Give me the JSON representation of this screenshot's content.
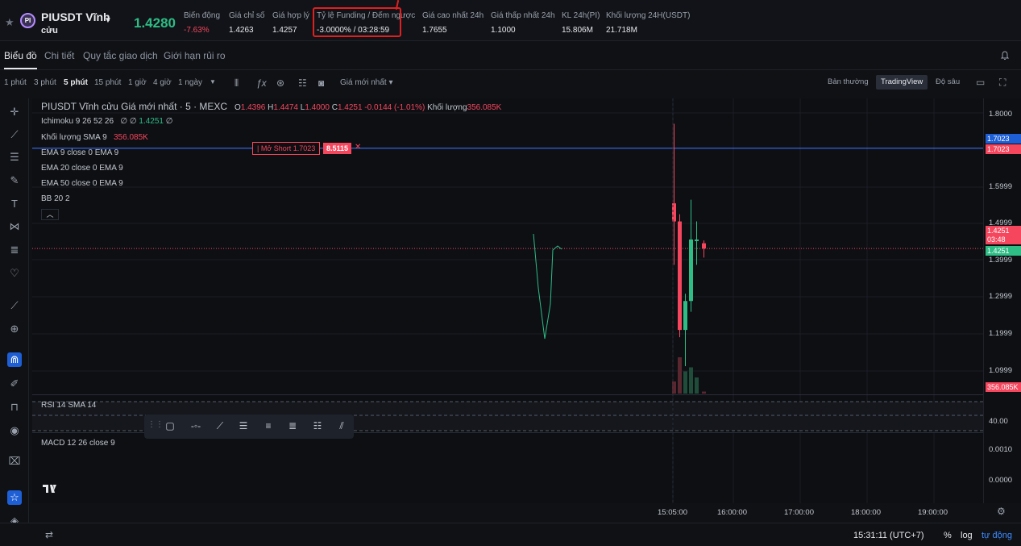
{
  "ticker": {
    "symbol": "PIUSDT Vĩnh",
    "symbol_line2": "cửu",
    "coin_icon": "PI",
    "last_price": "1.4280",
    "stats": [
      {
        "label": "Biến động",
        "value": "-7.63%",
        "tone": "red"
      },
      {
        "label": "Giá chỉ số",
        "value": "1.4263",
        "tone": "normal"
      },
      {
        "label": "Giá hợp lý",
        "value": "1.4257",
        "tone": "normal"
      },
      {
        "label": "Tỷ lệ Funding / Đếm ngược",
        "value": "-3.0000% / 03:28:59",
        "tone": "normal"
      },
      {
        "label": "Giá cao nhất 24h",
        "value": "1.7655",
        "tone": "normal"
      },
      {
        "label": "Giá thấp nhất 24h",
        "value": "1.1000",
        "tone": "normal"
      },
      {
        "label": "KL 24h(PI)",
        "value": "15.806M",
        "tone": "normal"
      },
      {
        "label": "Khối lượng 24H(USDT)",
        "value": "21.718M",
        "tone": "normal"
      }
    ]
  },
  "tabs": [
    "Biểu đồ",
    "Chi tiết",
    "Quy tắc giao dịch",
    "Giới hạn rủi ro"
  ],
  "toolbar": {
    "timeframes": [
      "1 phút",
      "3 phút",
      "5 phút",
      "15 phút",
      "1 giờ",
      "4 giờ",
      "1 ngày"
    ],
    "active_timeframe": "5 phút",
    "price_type": "Giá mới nhất",
    "views": [
      "Bản thường",
      "TradingView",
      "Độ sâu"
    ],
    "active_view": "TradingView"
  },
  "chart_header": {
    "title": "PIUSDT Vĩnh cửu Giá mới nhất · 5 · MEXC",
    "o_label": "O",
    "o": "1.4396",
    "h_label": "H",
    "h": "1.4474",
    "l_label": "L",
    "l": "1.4000",
    "c_label": "C",
    "c": "1.4251",
    "change": "-0.0144 (-1.01%)",
    "vol_label": "Khối lượng",
    "vol": "356.085K"
  },
  "indicators": {
    "ichimoku": "Ichimoku 9 26 52 26",
    "ichimoku_vals": "∅  ∅",
    "ichimoku_price": "1.4251",
    "ichimoku_end": "∅",
    "volume_sma": "Khối lượng SMA 9",
    "volume_sma_val": "356.085K",
    "ema9": "EMA 9 close 0 EMA 9",
    "ema20": "EMA 20 close 0 EMA 9",
    "ema50": "EMA 50 close 0 EMA 9",
    "bb": "BB 20 2",
    "rsi": "RSI 14 SMA 14",
    "macd": "MACD 12 26 close 9"
  },
  "short_order": {
    "label": "Mở Short 1.7023",
    "qty": "8.5115"
  },
  "price_axis": {
    "labels": [
      "1.8000",
      "1.5999",
      "1.4999",
      "1.3999",
      "1.2999",
      "1.1999",
      "1.0999"
    ],
    "short_line": "1.7023",
    "current": "1.4251",
    "countdown": "03:48",
    "volume_tag": "356.085K",
    "rsi_level": "40.00",
    "macd_levels": [
      "0.0010",
      "0.0000"
    ]
  },
  "time_axis": [
    "15:05:00",
    "16:00:00",
    "17:00:00",
    "18:00:00",
    "19:00:00"
  ],
  "footer": {
    "clock": "15:31:11 (UTC+7)",
    "percent": "%",
    "log": "log",
    "auto": "tự động"
  },
  "chart_data": {
    "type": "candlestick",
    "timeframe": "5 phút",
    "candles": [
      {
        "o": 1.55,
        "h": 1.77,
        "l": 1.38,
        "c": 1.5,
        "dir": "down"
      },
      {
        "o": 1.5,
        "h": 1.52,
        "l": 1.18,
        "c": 1.2,
        "dir": "down"
      },
      {
        "o": 1.2,
        "h": 1.3,
        "l": 1.1,
        "c": 1.28,
        "dir": "up"
      },
      {
        "o": 1.28,
        "h": 1.56,
        "l": 1.25,
        "c": 1.45,
        "dir": "up"
      },
      {
        "o": 1.45,
        "h": 1.5,
        "l": 1.38,
        "c": 1.45,
        "dir": "up"
      },
      {
        "o": 1.4396,
        "h": 1.4474,
        "l": 1.4,
        "c": 1.4251,
        "dir": "down"
      }
    ],
    "volume": [
      0.3,
      0.9,
      0.55,
      0.65,
      0.4,
      0.05
    ]
  },
  "colors": {
    "up": "#2ebd85",
    "down": "#f6465d",
    "short_line": "#3d6ff0",
    "annotation": "#e02020"
  }
}
